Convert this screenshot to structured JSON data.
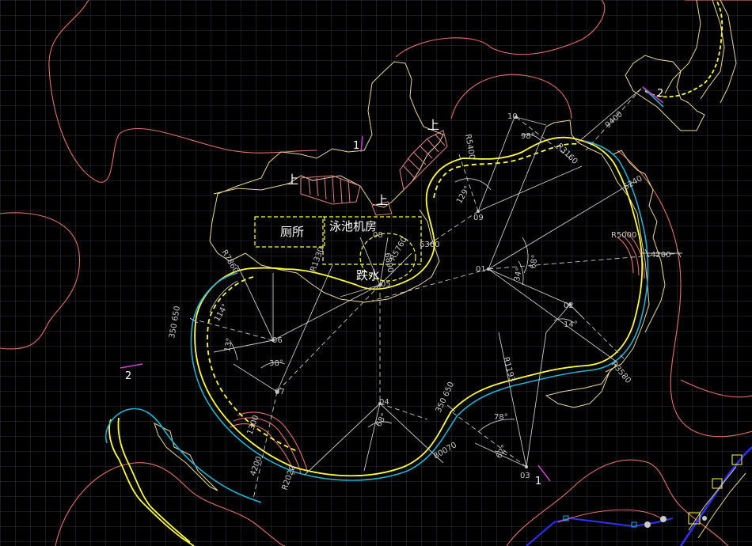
{
  "labels": {
    "toilet": "厕所",
    "pump_room": "泳池机房",
    "waterfall": "跌水",
    "up1": "上",
    "up2": "上",
    "up3": "上",
    "sect1_top": "1",
    "sect2_top": "2",
    "sect2_left": "2",
    "sect1_bottom": "1"
  },
  "points": {
    "p01": "01",
    "p02": "02",
    "p03": "03",
    "p04": "04",
    "p05": "05",
    "p06": "06",
    "p07": "07",
    "p08": "08",
    "p09": "09",
    "p10": "10"
  },
  "dimensions": {
    "d9400": "9400",
    "d6240": "6240",
    "d4200": "4200",
    "r5000": "R5000",
    "r5400": "R5400",
    "r3160": "R3160",
    "d6360": "6360",
    "r7860": "R7860",
    "r1330": "R1330",
    "d350_650_left": "350 650",
    "d350_650_mid": "350 650",
    "r1193": "R1193",
    "d6890": "6890",
    "d4200_low": "4200",
    "d1300": "1300",
    "r2020": "R2020",
    "d80070": "80070",
    "r3580": "R3580",
    "r5760": "R5760"
  },
  "angles": {
    "a129": "129°",
    "a98": "98°",
    "a68": "68°",
    "a34": "34°",
    "a14": "14°",
    "a114": "114°",
    "a13": "13°",
    "a38": "38°",
    "a68b": "68°",
    "a78": "78°",
    "a62": "62°"
  },
  "colors": {
    "background": "#000000",
    "grid": "#3c414f",
    "contour": "#e0706a",
    "building": "#e8d890",
    "pool_edge": "#ffff3c",
    "water_line": "#20b0d0",
    "construction": "#c8c8c8",
    "steps": "#e08090",
    "pipe": "#3030ff",
    "marker": "#d040d0"
  }
}
